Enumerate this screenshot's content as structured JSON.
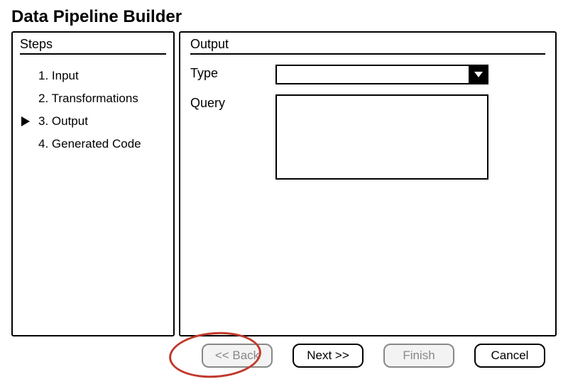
{
  "title": "Data Pipeline Builder",
  "sidebar": {
    "heading": "Steps",
    "items": [
      {
        "label": "1. Input"
      },
      {
        "label": "2. Transformations"
      },
      {
        "label": "3. Output"
      },
      {
        "label": "4. Generated Code"
      }
    ],
    "currentIndex": 2
  },
  "main": {
    "heading": "Output",
    "type_label": "Type",
    "type_value": "",
    "query_label": "Query",
    "query_value": ""
  },
  "footer": {
    "back_label": "<< Back",
    "next_label": "Next >>",
    "finish_label": "Finish",
    "cancel_label": "Cancel"
  }
}
